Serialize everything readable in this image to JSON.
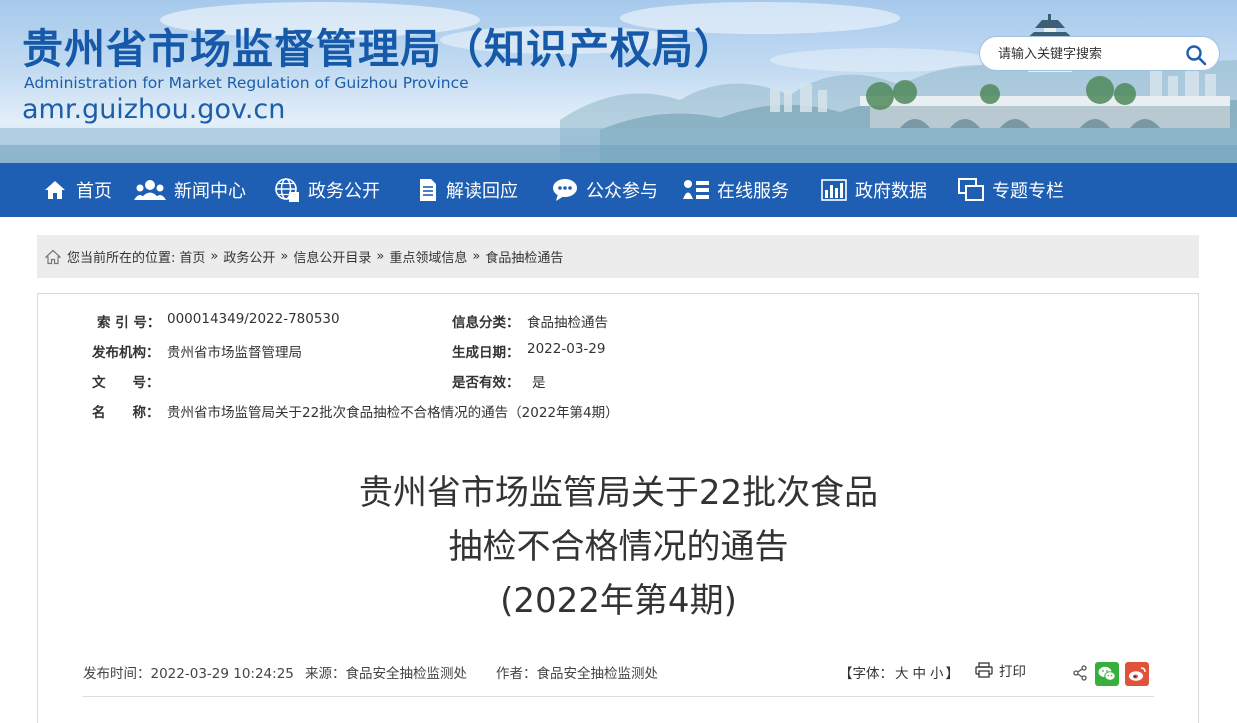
{
  "header": {
    "title": "贵州省市场监督管理局（知识产权局）",
    "subtitle": "Administration for Market Regulation of Guizhou Province",
    "domain": "amr.guizhou.gov.cn",
    "search_placeholder": "请输入关键字搜索"
  },
  "nav": {
    "items": [
      {
        "label": "首页",
        "icon": "home-icon"
      },
      {
        "label": "新闻中心",
        "icon": "people-icon"
      },
      {
        "label": "政务公开",
        "icon": "globe-icon"
      },
      {
        "label": "解读回应",
        "icon": "document-icon"
      },
      {
        "label": "公众参与",
        "icon": "chat-icon"
      },
      {
        "label": "在线服务",
        "icon": "user-list-icon"
      },
      {
        "label": "政府数据",
        "icon": "bar-chart-icon"
      },
      {
        "label": "专题专栏",
        "icon": "windows-icon"
      }
    ]
  },
  "breadcrumb": {
    "prefix": "您当前所在的位置:",
    "items": [
      "首页",
      "政务公开",
      "信息公开目录",
      "重点领域信息",
      "食品抽检通告"
    ],
    "separator": "»"
  },
  "meta": {
    "index_label": "索 引 号：",
    "index_value": "000014349/2022-780530",
    "category_label": "信息分类：",
    "category_value": "食品抽检通告",
    "publisher_label": "发布机构：",
    "publisher_value": "贵州省市场监督管理局",
    "date_label": "生成日期：",
    "date_value": "2022-03-29",
    "docno_label": "文　　号：",
    "docno_value": "",
    "valid_label": "是否有效：",
    "valid_value": "是",
    "name_label": "名　　称：",
    "name_value": "贵州省市场监管局关于22批次食品抽检不合格情况的通告（2022年第4期）"
  },
  "article": {
    "title_lines": [
      "贵州省市场监管局关于22批次食品",
      "抽检不合格情况的通告",
      "(2022年第4期)"
    ],
    "publish_time": "发布时间：2022-03-29 10:24:25",
    "source": "来源：食品安全抽检监测处",
    "author": "作者：食品安全抽检监测处",
    "font_size_prefix": "【字体：",
    "font_size_large": "大",
    "font_size_medium": "中",
    "font_size_small": "小",
    "font_size_suffix": "】",
    "print_label": "打印"
  },
  "colors": {
    "nav_bg": "#1f5fb3",
    "title_blue": "#1559a8",
    "wechat_green": "#36b03a",
    "weibo_red": "#e1523b"
  }
}
